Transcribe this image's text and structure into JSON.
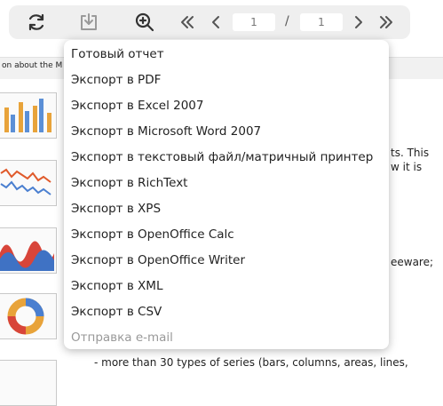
{
  "toolbar": {
    "current_page": "1",
    "separator": "/",
    "total_pages": "1",
    "icons": {
      "refresh": "refresh-icon",
      "save": "save-icon",
      "zoom": "zoom-in-icon",
      "first": "first-page-icon",
      "prev": "prev-page-icon",
      "next": "next-page-icon",
      "last": "last-page-icon"
    }
  },
  "document": {
    "header_fragment": "on about the M",
    "text_fragments": [
      "ts. This",
      "w  it  is",
      "eeware;",
      "- more than 30 types of series (bars, columns, areas, lines,"
    ]
  },
  "save_menu": {
    "items": [
      {
        "label": "Готовый отчет",
        "enabled": true
      },
      {
        "label": "Экспорт в PDF",
        "enabled": true
      },
      {
        "label": "Экспорт в Excel 2007",
        "enabled": true
      },
      {
        "label": "Экспорт в Microsoft Word 2007",
        "enabled": true
      },
      {
        "label": "Экспорт в текстовый файл/матричный принтер",
        "enabled": true
      },
      {
        "label": "Экспорт в RichText",
        "enabled": true
      },
      {
        "label": "Экспорт в XPS",
        "enabled": true
      },
      {
        "label": "Экспорт в OpenOffice Calc",
        "enabled": true
      },
      {
        "label": "Экспорт в OpenOffice Writer",
        "enabled": true
      },
      {
        "label": "Экспорт в XML",
        "enabled": true
      },
      {
        "label": "Экспорт в CSV",
        "enabled": true
      },
      {
        "label": "Отправка e-mail",
        "enabled": false
      }
    ]
  },
  "colors": {
    "toolbar_bg": "#efefef",
    "icon": "#333333",
    "icon_muted": "#9a9a9a",
    "disabled_text": "#999999"
  }
}
